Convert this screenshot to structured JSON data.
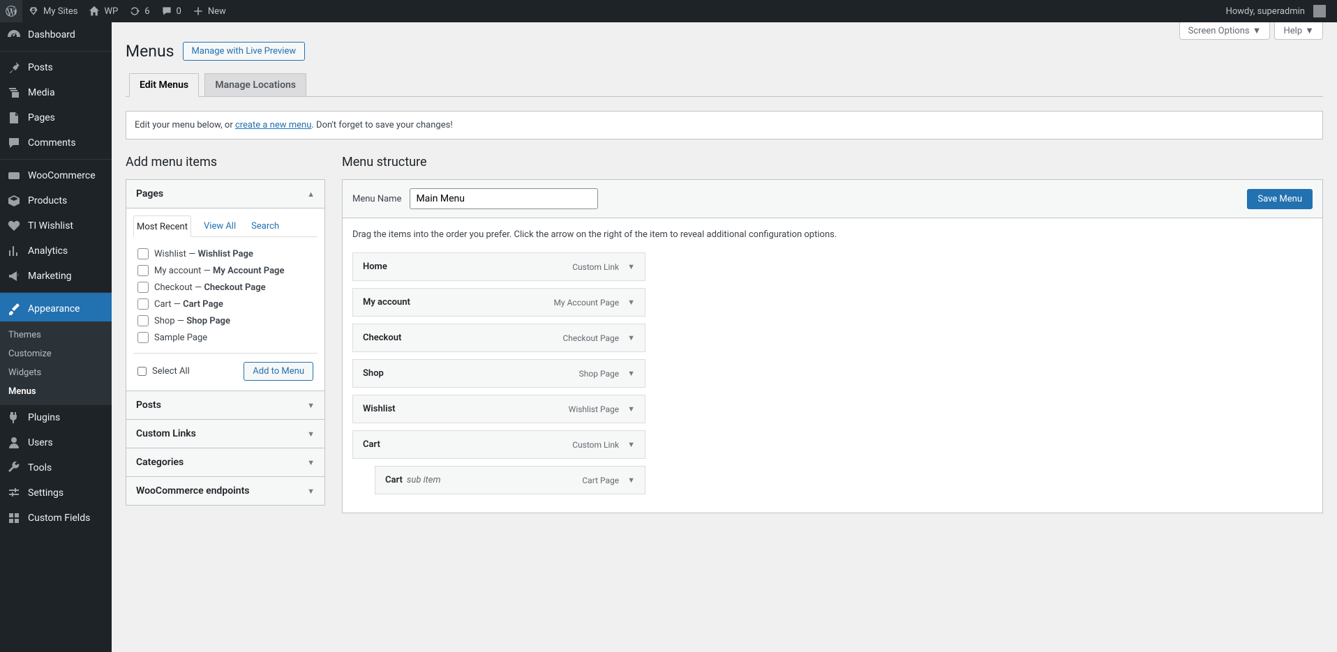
{
  "adminbar": {
    "my_sites": "My Sites",
    "site_name": "WP",
    "updates": "6",
    "comments": "0",
    "new": "New",
    "howdy": "Howdy, superadmin"
  },
  "sidemenu": {
    "dashboard": "Dashboard",
    "posts": "Posts",
    "media": "Media",
    "pages": "Pages",
    "comments": "Comments",
    "woocommerce": "WooCommerce",
    "products": "Products",
    "wishlist": "TI Wishlist",
    "analytics": "Analytics",
    "marketing": "Marketing",
    "appearance": "Appearance",
    "plugins": "Plugins",
    "users": "Users",
    "tools": "Tools",
    "settings": "Settings",
    "custom_fields": "Custom Fields",
    "sub": {
      "themes": "Themes",
      "customize": "Customize",
      "widgets": "Widgets",
      "menus": "Menus"
    }
  },
  "screen_meta": {
    "screen_options": "Screen Options",
    "help": "Help"
  },
  "page": {
    "title": "Menus",
    "live_preview": "Manage with Live Preview",
    "tab_edit": "Edit Menus",
    "tab_locations": "Manage Locations",
    "notice_pre": "Edit your menu below, or ",
    "notice_link": "create a new menu",
    "notice_post": ". Don't forget to save your changes!"
  },
  "add_items": {
    "heading": "Add menu items",
    "panels": {
      "pages": "Pages",
      "posts": "Posts",
      "custom": "Custom Links",
      "cats": "Categories",
      "wc": "WooCommerce endpoints"
    },
    "tabs": {
      "recent": "Most Recent",
      "view_all": "View All",
      "search": "Search"
    },
    "list": [
      {
        "pre": "Wishlist — ",
        "bold": "Wishlist Page"
      },
      {
        "pre": "My account — ",
        "bold": "My Account Page"
      },
      {
        "pre": "Checkout — ",
        "bold": "Checkout Page"
      },
      {
        "pre": "Cart — ",
        "bold": "Cart Page"
      },
      {
        "pre": "Shop — ",
        "bold": "Shop Page"
      },
      {
        "pre": "Sample Page",
        "bold": ""
      }
    ],
    "select_all": "Select All",
    "add_to_menu": "Add to Menu"
  },
  "structure": {
    "heading": "Menu structure",
    "name_label": "Menu Name",
    "name_value": "Main Menu",
    "save": "Save Menu",
    "hint": "Drag the items into the order you prefer. Click the arrow on the right of the item to reveal additional configuration options.",
    "items": [
      {
        "name": "Home",
        "type": "Custom Link",
        "indent": false
      },
      {
        "name": "My account",
        "type": "My Account Page",
        "indent": false
      },
      {
        "name": "Checkout",
        "type": "Checkout Page",
        "indent": false
      },
      {
        "name": "Shop",
        "type": "Shop Page",
        "indent": false
      },
      {
        "name": "Wishlist",
        "type": "Wishlist Page",
        "indent": false
      },
      {
        "name": "Cart",
        "type": "Custom Link",
        "indent": false
      },
      {
        "name": "Cart",
        "type": "Cart Page",
        "indent": true,
        "sub": "sub item"
      }
    ]
  }
}
